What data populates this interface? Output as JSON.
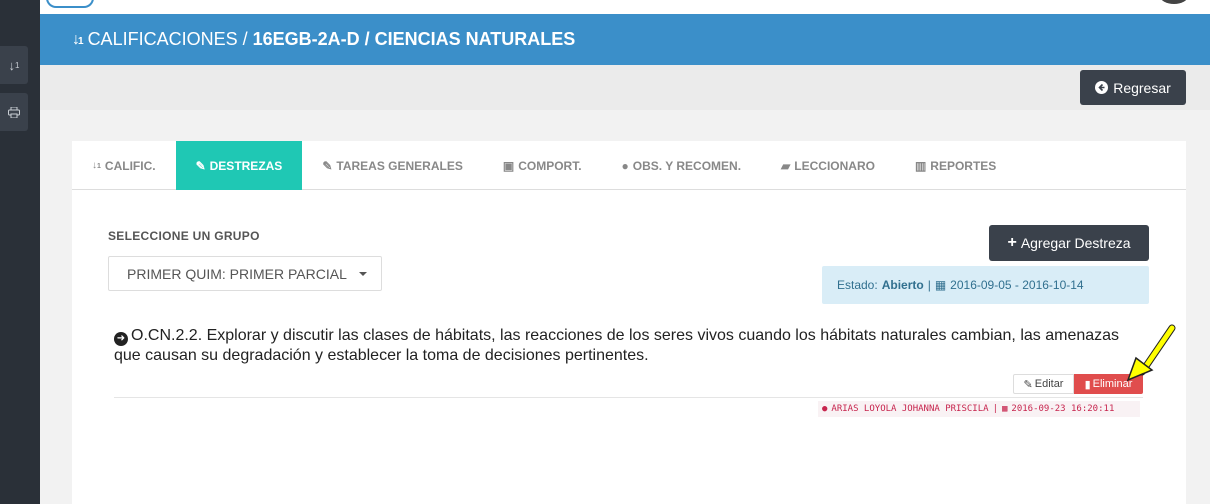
{
  "header": {
    "title_prefix": "CALIFICACIONES / ",
    "title_bold": "16EGB-2A-D / CIENCIAS NATURALES"
  },
  "toolbar": {
    "back_label": "Regresar"
  },
  "tabs": [
    {
      "label": "CALIFIC.",
      "icon": "sort-numeric-icon",
      "active": false
    },
    {
      "label": "DESTREZAS",
      "icon": "edit-icon",
      "active": true
    },
    {
      "label": "TAREAS GENERALES",
      "icon": "edit-icon",
      "active": false
    },
    {
      "label": "COMPORT.",
      "icon": "comment-icon",
      "active": false
    },
    {
      "label": "OBS. Y RECOMEN.",
      "icon": "comments-icon",
      "active": false
    },
    {
      "label": "LECCIONARO",
      "icon": "book-icon",
      "active": false
    },
    {
      "label": "REPORTES",
      "icon": "bar-chart-icon",
      "active": false
    }
  ],
  "group": {
    "label": "SELECCIONE UN GRUPO",
    "selected": "PRIMER QUIM: PRIMER PARCIAL"
  },
  "add_button": "Agregar Destreza",
  "status": {
    "prefix": "Estado:",
    "value": "Abierto",
    "range": "2016-09-05 - 2016-10-14"
  },
  "destreza": {
    "text": "O.CN.2.2. Explorar y discutir las clases de hábitats, las reacciones de los seres vivos cuando los hábitats naturales cambian, las amenazas que causan su degradación y establecer la toma de decisiones pertinentes.",
    "edit_label": "Editar",
    "delete_label": "Eliminar",
    "author": "ARIAS LOYOLA JOHANNA PRISCILA",
    "date": "2016-09-23 16:20:11"
  },
  "colors": {
    "header": "#3b8fc9",
    "active_tab": "#1fc8b4",
    "dark_button": "#3a414b",
    "danger": "#e04d4d",
    "info_bg": "#d9edf7",
    "annotation": "#ffff00"
  }
}
